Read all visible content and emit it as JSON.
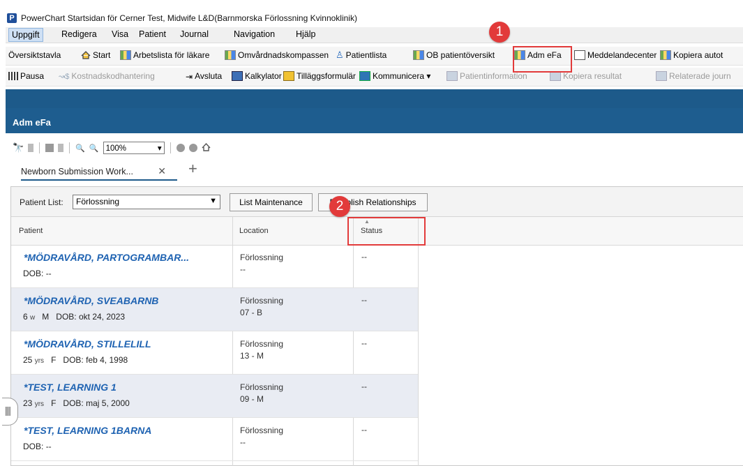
{
  "window": {
    "icon_letter": "P",
    "title": "PowerChart Startsidan för Cerner Test, Midwife L&D(Barnmorska Förlossning Kvinnoklinik)"
  },
  "menu": [
    "Uppgift",
    "Redigera",
    "Visa",
    "Patient",
    "Journal",
    "Navigation",
    "Hjälp"
  ],
  "toolbar1": [
    {
      "label": "Översiktstavla",
      "icon": "none"
    },
    {
      "label": "Start",
      "icon": "home-icon"
    },
    {
      "label": "Arbetslista för läkare",
      "icon": "grid-icon"
    },
    {
      "label": "Omvårdnadskompassen",
      "icon": "grid-icon"
    },
    {
      "label": "Patientlista",
      "icon": "person-icon"
    },
    {
      "label": "OB patientöversikt",
      "icon": "grid-icon"
    },
    {
      "label": "Adm eFa",
      "icon": "grid-icon"
    },
    {
      "label": "Meddelandecenter",
      "icon": "mail-icon"
    },
    {
      "label": "Kopiera autot",
      "icon": "grid-icon"
    }
  ],
  "toolbar2": [
    {
      "label": "Pausa",
      "icon": "pause-icon",
      "disabled": false
    },
    {
      "label": "Kostnadskodhantering",
      "icon": "cost-icon",
      "disabled": true
    },
    {
      "label": "Avsluta",
      "icon": "exit-icon",
      "disabled": false
    },
    {
      "label": "Kalkylator",
      "icon": "calculator-icon",
      "disabled": false
    },
    {
      "label": "Tilläggsformulär",
      "icon": "form-icon",
      "disabled": false
    },
    {
      "label": "Kommunicera ▾",
      "icon": "communicate-icon",
      "disabled": false
    },
    {
      "label": "Patientinformation",
      "icon": "info-icon",
      "disabled": true
    },
    {
      "label": "Kopiera resultat",
      "icon": "copy-icon",
      "disabled": true
    },
    {
      "label": "Relaterade journ",
      "icon": "related-icon",
      "disabled": true
    }
  ],
  "page": {
    "title": "Adm eFa",
    "zoom": "100%"
  },
  "tab": {
    "label": "Newborn Submission Work...",
    "close": "✕",
    "add": "+"
  },
  "filter": {
    "label": "Patient List:",
    "selected": "Förlossning",
    "btn_list_maintenance": "List Maintenance",
    "btn_establish": "Establish Relationships"
  },
  "columns": {
    "patient": "Patient",
    "location": "Location",
    "status": "Status"
  },
  "patients": [
    {
      "name": "*MÖDRAVÅRD, PARTOGRAMBAR...",
      "age": "",
      "age_unit": "",
      "sex": "",
      "dob_label": "DOB:",
      "dob": "--",
      "location": "Förlossning",
      "bed": "--",
      "status": "--"
    },
    {
      "name": "*MÖDRAVÅRD, SVEABARNB",
      "age": "6",
      "age_unit": "w",
      "sex": "M",
      "dob_label": "DOB:",
      "dob": "okt 24, 2023",
      "location": "Förlossning",
      "bed": "07 - B",
      "status": "--"
    },
    {
      "name": "*MÖDRAVÅRD, STILLELILL",
      "age": "25",
      "age_unit": "yrs",
      "sex": "F",
      "dob_label": "DOB:",
      "dob": "feb 4, 1998",
      "location": "Förlossning",
      "bed": "13 - M",
      "status": "--"
    },
    {
      "name": "*TEST, LEARNING 1",
      "age": "23",
      "age_unit": "yrs",
      "sex": "F",
      "dob_label": "DOB:",
      "dob": "maj 5, 2000",
      "location": "Förlossning",
      "bed": "09 - M",
      "status": "--"
    },
    {
      "name": "*TEST, LEARNING 1BARNA",
      "age": "",
      "age_unit": "",
      "sex": "",
      "dob_label": "DOB:",
      "dob": "--",
      "location": "Förlossning",
      "bed": "--",
      "status": "--"
    }
  ],
  "callouts": [
    "1",
    "2"
  ],
  "colors": {
    "accent_blue": "#1d5a8a",
    "link_blue": "#1f63b2",
    "callout_red": "#e23a3a",
    "alt_row": "#e9ecf3"
  }
}
